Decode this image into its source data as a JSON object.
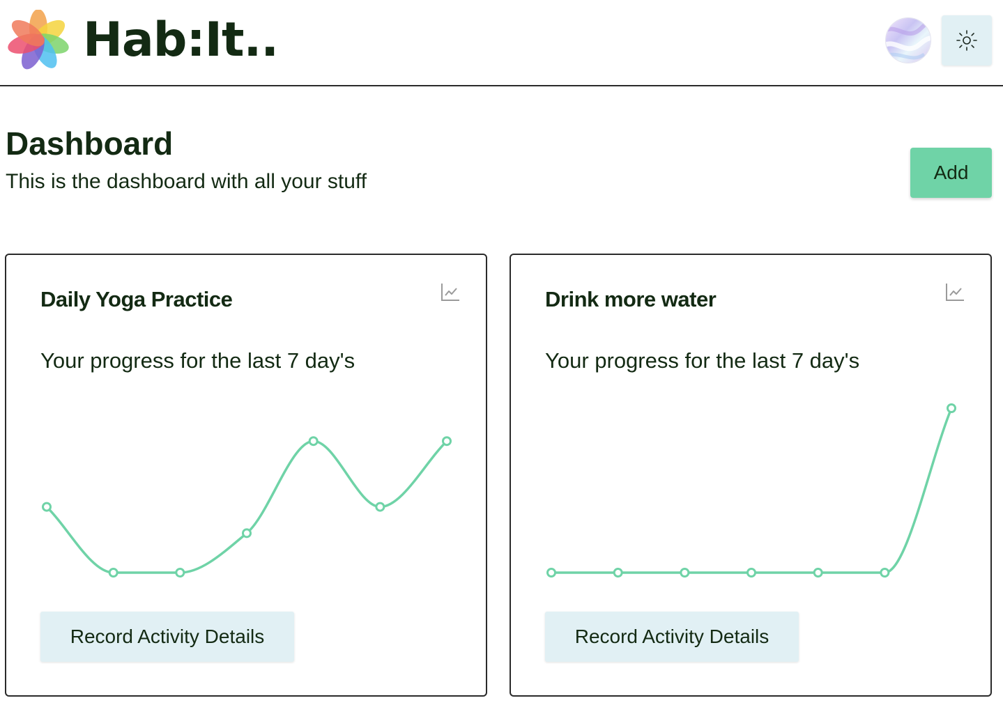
{
  "header": {
    "brand": "Hab:It..",
    "logo_icon": "flower-logo-icon",
    "avatar_icon": "holographic-avatar",
    "theme_toggle_icon": "sun-icon"
  },
  "dashboard": {
    "title": "Dashboard",
    "subtitle": "This is the dashboard with all your stuff",
    "add_label": "Add"
  },
  "colors": {
    "accent": "#6fd3a7",
    "text": "#132a13",
    "button_secondary": "#e1f0f4"
  },
  "habits": [
    {
      "title": "Daily Yoga Practice",
      "subtitle": "Your progress for the last 7 day's",
      "icon": "line-chart-icon",
      "button_label": "Record Activity Details"
    },
    {
      "title": "Drink more water",
      "subtitle": "Your progress for the last 7 day's",
      "icon": "line-chart-icon",
      "button_label": "Record Activity Details"
    }
  ],
  "chart_data": [
    {
      "type": "line",
      "x": [
        1,
        2,
        3,
        4,
        5,
        6,
        7
      ],
      "values": [
        2,
        0,
        0,
        1.2,
        4,
        2,
        4
      ],
      "ylim": [
        0,
        5
      ],
      "grid": false,
      "color": "#6fd3a7"
    },
    {
      "type": "line",
      "x": [
        1,
        2,
        3,
        4,
        5,
        6,
        7
      ],
      "values": [
        0,
        0,
        0,
        0,
        0,
        0,
        5
      ],
      "ylim": [
        0,
        5
      ],
      "grid": false,
      "color": "#6fd3a7"
    }
  ]
}
